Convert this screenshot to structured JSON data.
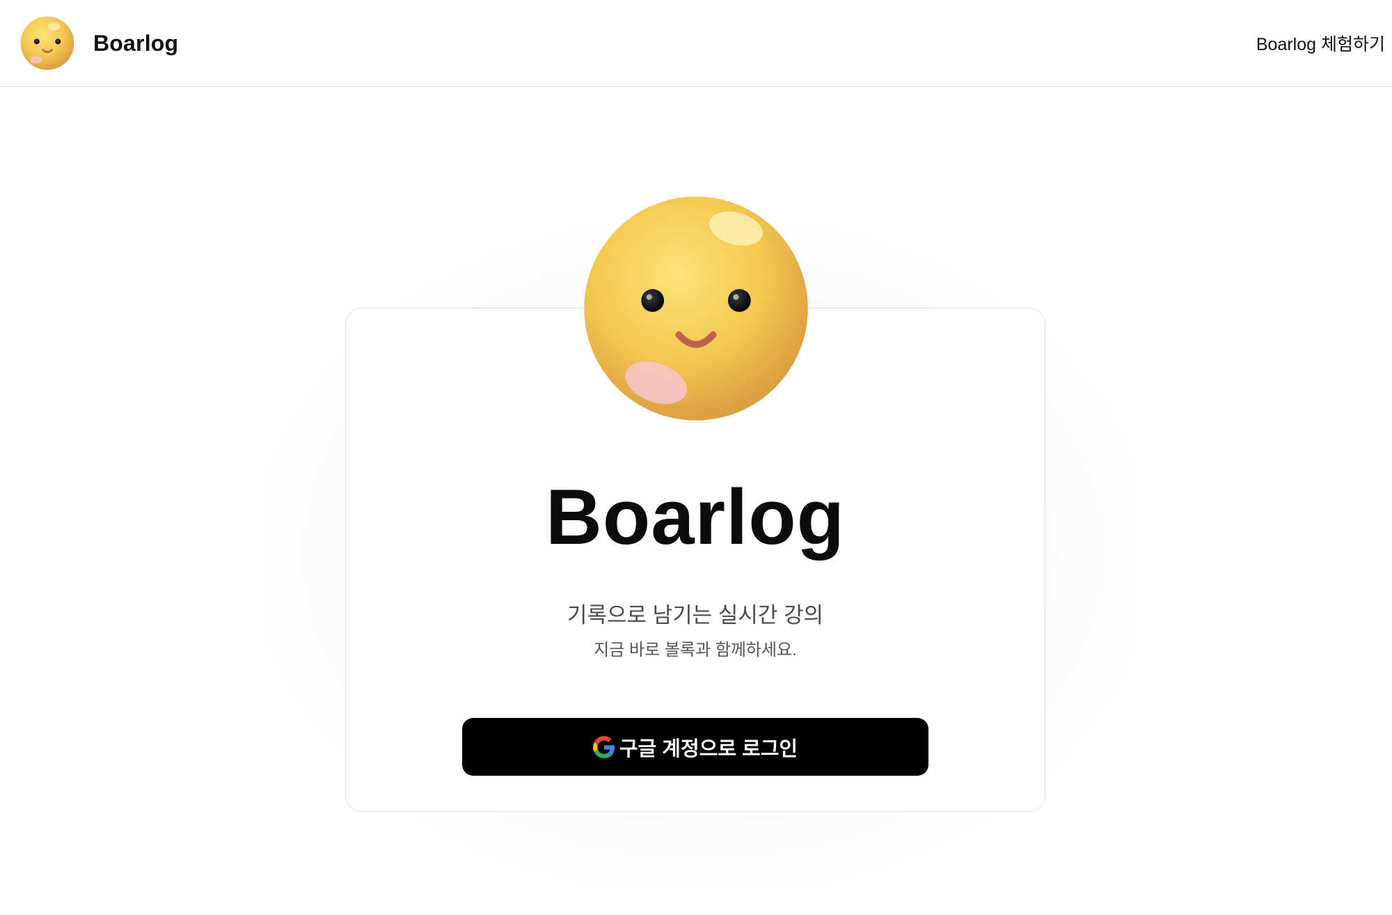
{
  "header": {
    "brand_name": "Boarlog",
    "nav_link": "Boarlog 체험하기",
    "logo_icon": "smiley-face-icon"
  },
  "hero": {
    "mascot_icon": "smiley-face-icon",
    "title": "Boarlog",
    "tagline": "기록으로 남기는 실시간 강의",
    "subline": "지금 바로 볼록과 함께하세요.",
    "login_button": "구글 계정으로 로그인",
    "login_icon": "google-g-icon"
  },
  "colors": {
    "accent_yellow": "#f2c94c",
    "button_bg": "#000000",
    "button_text": "#ffffff"
  }
}
